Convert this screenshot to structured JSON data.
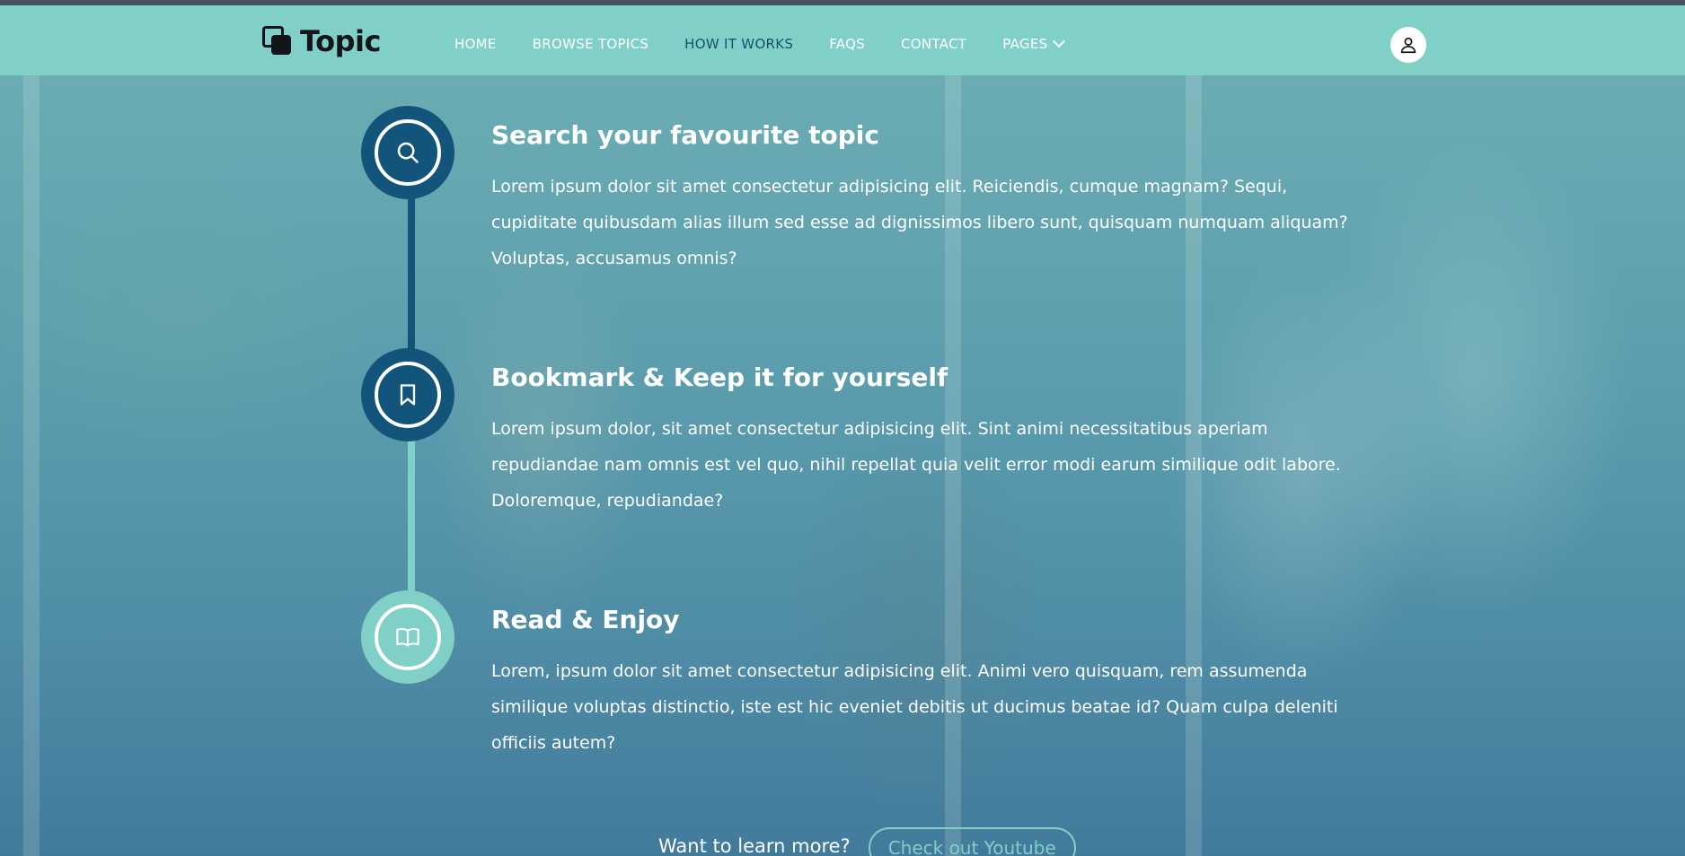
{
  "brand": {
    "name": "Topic"
  },
  "nav": {
    "items": [
      {
        "label": "HOME"
      },
      {
        "label": "BROWSE TOPICS"
      },
      {
        "label": "HOW IT WORKS"
      },
      {
        "label": "FAQS"
      },
      {
        "label": "CONTACT"
      },
      {
        "label": "PAGES"
      }
    ]
  },
  "steps": [
    {
      "icon": "search-icon",
      "title": "Search your favourite topic",
      "text": "Lorem ipsum dolor sit amet consectetur adipisicing elit. Reiciendis, cumque magnam? Sequi, cupiditate quibusdam alias illum sed esse ad dignissimos libero sunt, quisquam numquam aliquam? Voluptas, accusamus omnis?"
    },
    {
      "icon": "bookmark-icon",
      "title": "Bookmark & Keep it for yourself",
      "text": "Lorem ipsum dolor, sit amet consectetur adipisicing elit. Sint animi necessitatibus aperiam repudiandae nam omnis est vel quo, nihil repellat quia velit error modi earum similique odit labore. Doloremque, repudiandae?"
    },
    {
      "icon": "book-icon",
      "title": "Read & Enjoy",
      "text": "Lorem, ipsum dolor sit amet consectetur adipisicing elit. Animi vero quisquam, rem assumenda similique voluptas distinctio, iste est hic eveniet debitis ut ducimus beatae id? Quam culpa deleniti officiis autem?"
    }
  ],
  "cta": {
    "text": "Want to learn more?",
    "button_label": "Check out Youtube"
  },
  "colors": {
    "nav_bg": "#80d0c7",
    "primary_dark": "#13547a",
    "accent": "#80d0c7",
    "active_nav": "#174f72"
  }
}
